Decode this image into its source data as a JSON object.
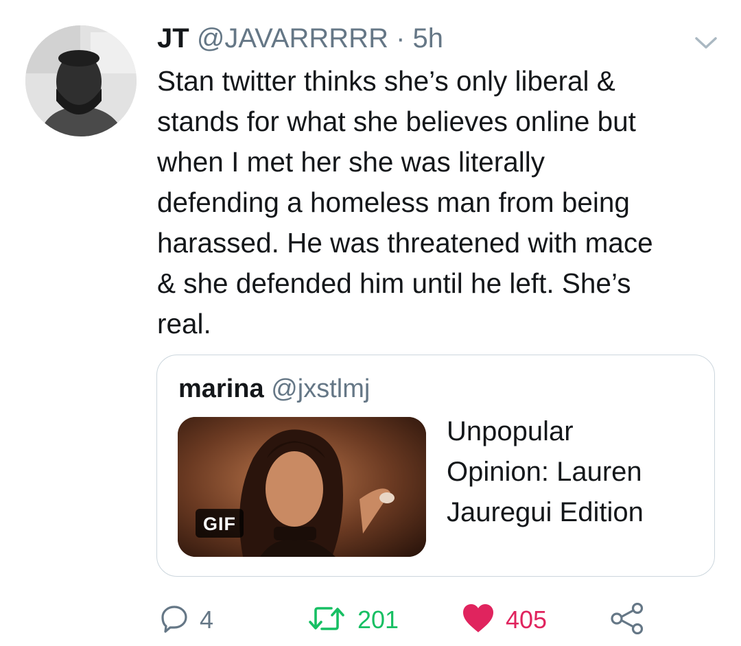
{
  "tweet": {
    "display_name": "JT",
    "handle": "@JAVARRRRR",
    "separator": "·",
    "time": "5h",
    "text": "Stan twitter thinks she’s only liberal &\nstands for what she believes online but\nwhen I met her she was literally\ndefending a homeless man from being\nharassed. He was threatened with mace\n& she defended him until he left. She’s\nreal."
  },
  "quoted_tweet": {
    "display_name": "marina",
    "handle": "@jxstlmj",
    "media_badge": "GIF",
    "text": "Unpopular\nOpinion: Lauren\nJauregui Edition"
  },
  "actions": {
    "reply_count": "4",
    "retweet_count": "201",
    "like_count": "405"
  },
  "icons": {
    "reply": "reply-icon",
    "retweet": "retweet-icon",
    "like": "heart-icon",
    "share": "share-icon",
    "menu": "chevron-down-icon"
  },
  "colors": {
    "text": "#14171a",
    "secondary": "#657786",
    "retweet": "#17bf63",
    "like": "#e0245e",
    "border": "#ccd6dd"
  }
}
